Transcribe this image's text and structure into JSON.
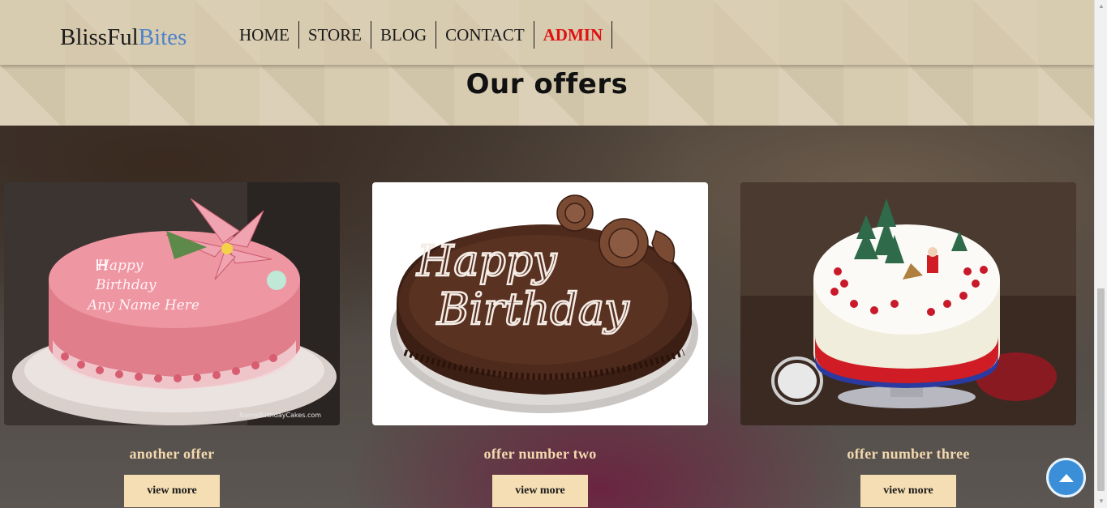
{
  "brand": {
    "name_part1": "BlissFul",
    "name_part2": "Bites"
  },
  "nav": {
    "items": [
      {
        "label": "HOME"
      },
      {
        "label": "STORE"
      },
      {
        "label": "BLOG"
      },
      {
        "label": "CONTACT"
      },
      {
        "label": "ADMIN"
      }
    ]
  },
  "section": {
    "title": "Our offers"
  },
  "offers": [
    {
      "title": "another offer",
      "button": "view more",
      "image": "pink-birthday-cake"
    },
    {
      "title": "offer number two",
      "button": "view more",
      "image": "chocolate-birthday-cake"
    },
    {
      "title": "offer number three",
      "button": "view more",
      "image": "christmas-cake"
    }
  ],
  "icons": {
    "back_to_top": "arrow-up-icon"
  },
  "colors": {
    "brand_accent": "#4f82c8",
    "admin": "#e01010",
    "offer_title": "#f2d8ae",
    "button_bg": "#f5deb3",
    "back_to_top": "#3a8fd8"
  }
}
